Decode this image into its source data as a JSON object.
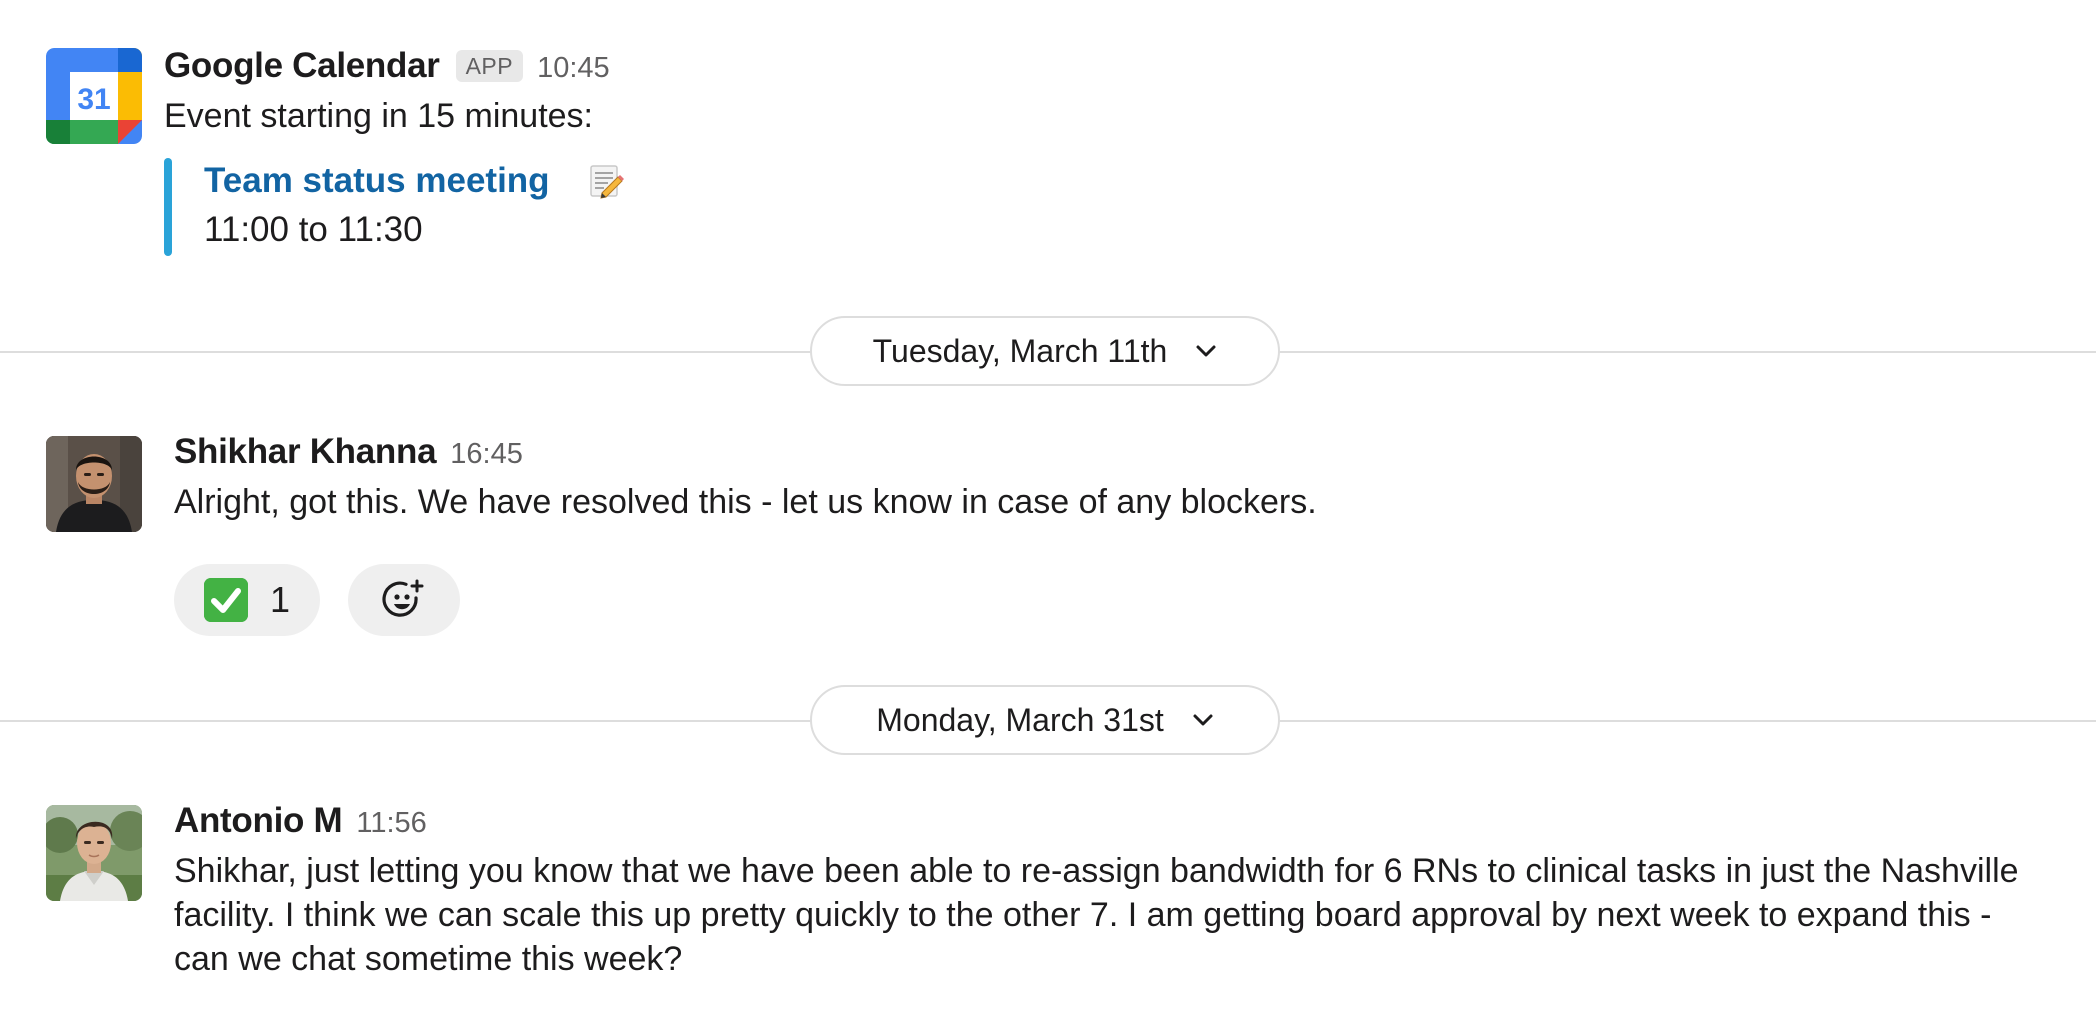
{
  "messages": [
    {
      "sender": "Google Calendar",
      "badge": "APP",
      "time": "10:45",
      "text": "Event starting in 15 minutes:",
      "attachment": {
        "title": "Team status meeting",
        "time_range": "11:00 to 11:30",
        "icon": "memo-icon"
      },
      "avatar": {
        "type": "google-calendar-icon",
        "day": "31"
      }
    },
    {
      "sender": "Shikhar Khanna",
      "time": "16:45",
      "text": "Alright, got this. We have resolved this - let us know in case of any blockers.",
      "reactions": [
        {
          "emoji": "white-check-mark",
          "count": "1"
        }
      ]
    },
    {
      "sender": "Antonio M",
      "time": "11:56",
      "text": "Shikhar, just letting you know that we have been able to re-assign bandwidth for 6 RNs to clinical tasks in just the Nashville facility. I think we can scale this up pretty quickly to the other 7. I am getting board approval by next week to expand this - can we chat sometime this week?"
    }
  ],
  "dividers": [
    {
      "label": "Tuesday, March 11th"
    },
    {
      "label": "Monday, March 31st"
    }
  ],
  "colors": {
    "link": "#1264a3",
    "attachment_bar": "#2aa3d8",
    "divider": "#dddddd",
    "reaction_bg": "#efefef"
  }
}
